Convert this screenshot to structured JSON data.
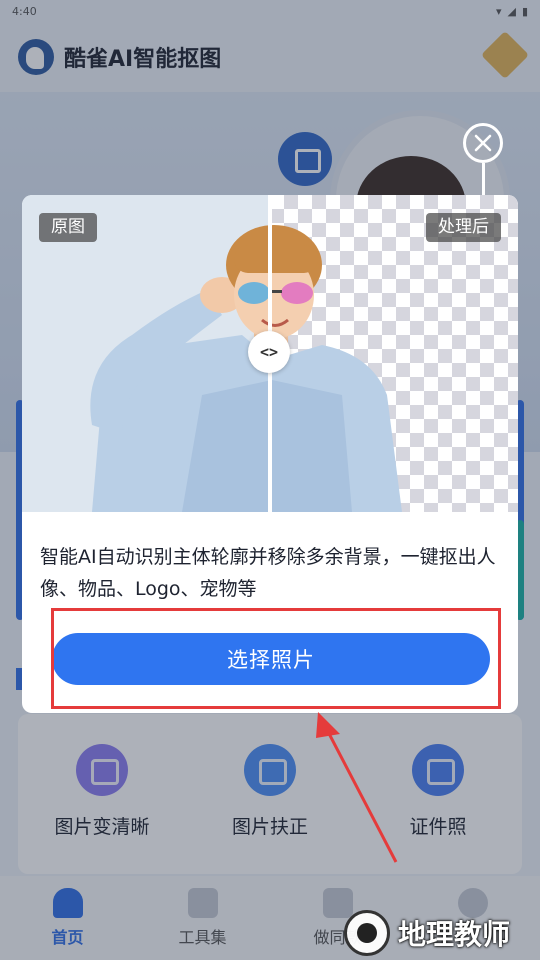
{
  "status_bar": {
    "time": "4:40"
  },
  "app": {
    "title": "酷雀AI智能抠图"
  },
  "tools": [
    {
      "label": "图片变清晰",
      "color": "#8c7cf0"
    },
    {
      "label": "图片扶正",
      "color": "#4d8ff5"
    },
    {
      "label": "证件照",
      "color": "#4a7ef0"
    }
  ],
  "tabs": [
    {
      "label": "首页",
      "active": true
    },
    {
      "label": "工具集",
      "active": false
    },
    {
      "label": "做同款",
      "active": false
    }
  ],
  "dialog": {
    "tag_original": "原图",
    "tag_processed": "处理后",
    "handle_glyph": "<>",
    "description": "智能AI自动识别主体轮廓并移除多余背景，一键抠出人像、物品、Logo、宠物等",
    "choose_button": "选择照片"
  },
  "watermark": {
    "text": "地理教师"
  },
  "colors": {
    "accent": "#2f75f0",
    "highlight": "#e53b3b"
  }
}
